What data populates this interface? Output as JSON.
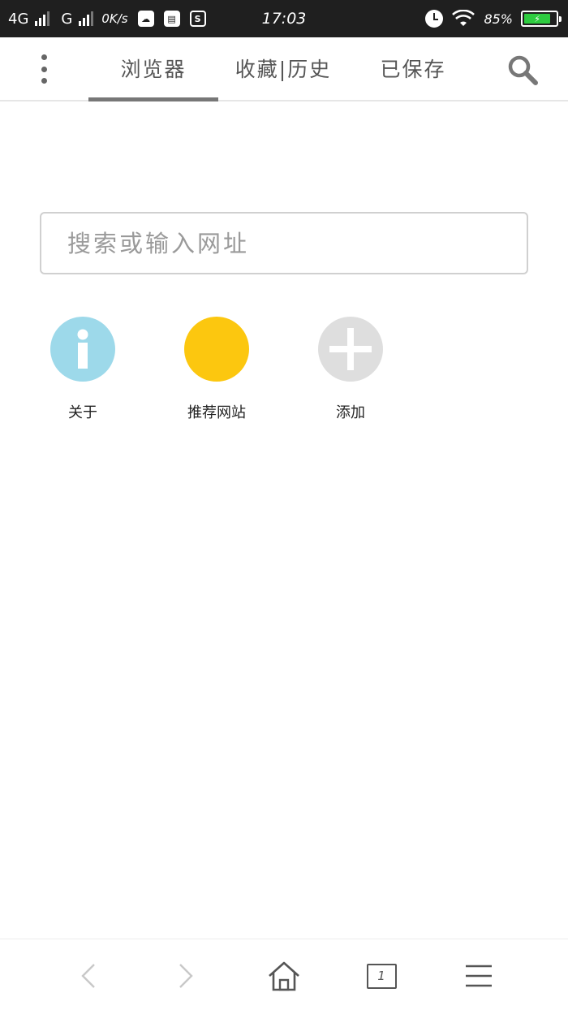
{
  "status_bar": {
    "network1": "4G",
    "network2": "G",
    "speed": "0K/s",
    "s_badge": "S",
    "time": "17:03",
    "battery": "85%"
  },
  "tabs": {
    "browser": "浏览器",
    "bookmarks_history": "收藏|历史",
    "saved": "已保存"
  },
  "address_bar": {
    "placeholder": "搜索或输入网址"
  },
  "speed_dial": [
    {
      "label": "关于",
      "color": "#9dd9ea"
    },
    {
      "label": "推荐网站",
      "color": "#fcc70f"
    },
    {
      "label": "添加",
      "color": "#dedede"
    }
  ],
  "bottom_bar": {
    "tab_count": "1"
  },
  "colors": {
    "accent_indicator": "#777777",
    "status_bar_bg": "#1f1f1f"
  }
}
